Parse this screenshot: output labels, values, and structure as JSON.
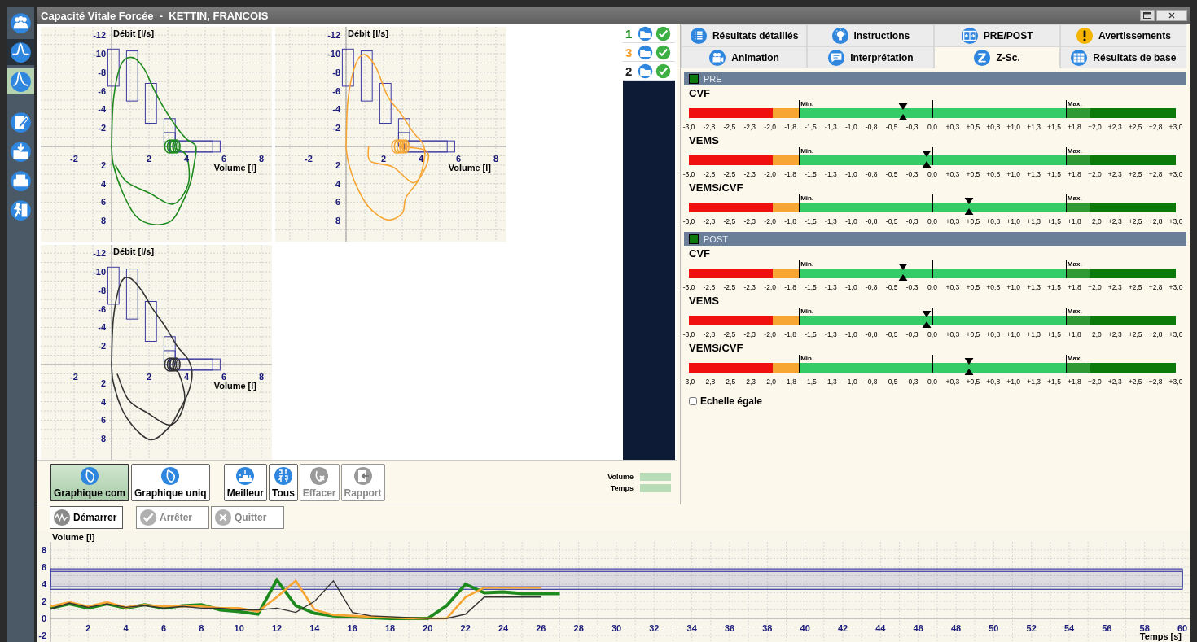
{
  "window": {
    "title": "Capacité Vitale Forcée  -  KETTIN, FRANCOIS"
  },
  "sidebar": {
    "items": [
      {
        "kind": "patients",
        "selected": false,
        "highlighted": false
      },
      {
        "kind": "wave",
        "selected": false,
        "highlighted": true
      },
      {
        "kind": "peak",
        "selected": true,
        "highlighted": false
      },
      {
        "kind": "edit",
        "selected": false,
        "highlighted": false
      },
      {
        "kind": "import",
        "selected": false,
        "highlighted": false
      },
      {
        "kind": "print",
        "selected": false,
        "highlighted": false
      },
      {
        "kind": "exit",
        "selected": false,
        "highlighted": false
      }
    ]
  },
  "flow_volume_charts": [
    {
      "ylabel": "Débit [l/s]",
      "xlabel": "Volume [l]",
      "color": "#1e8a1e",
      "yticks": [
        "-12",
        "-10",
        "-8",
        "-6",
        "-4",
        "-2",
        "2",
        "4",
        "6",
        "8"
      ],
      "xticks": [
        "-2",
        "2",
        "4",
        "6",
        "8"
      ]
    },
    {
      "ylabel": "Débit [l/s]",
      "xlabel": "Volume [l]",
      "color": "#f7a533",
      "yticks": [
        "-12",
        "-10",
        "-8",
        "-6",
        "-4",
        "-2",
        "2",
        "4",
        "6",
        "8"
      ],
      "xticks": [
        "-2",
        "2",
        "4",
        "6",
        "8"
      ]
    },
    {
      "ylabel": "Débit [l/s]",
      "xlabel": "Volume [l]",
      "color": "#333333",
      "yticks": [
        "-12",
        "-10",
        "-8",
        "-6",
        "-4",
        "-2",
        "2",
        "4",
        "6",
        "8"
      ],
      "xticks": [
        "-2",
        "2",
        "4",
        "6",
        "8"
      ]
    }
  ],
  "trials": [
    {
      "number": "1",
      "color": "#1a8a1a"
    },
    {
      "number": "3",
      "color": "#f39a1f"
    },
    {
      "number": "2",
      "color": "#222222"
    }
  ],
  "tab_rows": [
    [
      {
        "label": "Résultats détaillés",
        "kind": "list",
        "selected": false
      },
      {
        "label": "Instructions",
        "kind": "bulb",
        "selected": false
      },
      {
        "label": "PRE/POST",
        "kind": "prepost",
        "selected": false
      },
      {
        "label": "Avertissements",
        "kind": "warning",
        "selected": false
      }
    ],
    [
      {
        "label": "Animation",
        "kind": "camera",
        "selected": false
      },
      {
        "label": "Interprétation",
        "kind": "chat",
        "selected": false
      },
      {
        "label": "Z-Sc.",
        "kind": "z",
        "selected": true
      },
      {
        "label": "Résultats de base",
        "kind": "grid",
        "selected": false
      }
    ]
  ],
  "zscore": {
    "sections": [
      {
        "title": "PRE",
        "metrics": [
          {
            "name": "CVF",
            "min_label": "Min.",
            "max_label": "Max.",
            "level": 0.44,
            "ticks": [
              "-3,0",
              "-2,8",
              "-2,5",
              "-2,3",
              "-2,0",
              "-1,8",
              "-1,5",
              "-1,3",
              "-1,0",
              "-0,8",
              "-0,5",
              "-0,3",
              "0,0",
              "+0,3",
              "+0,5",
              "+0,8",
              "+1,0",
              "+1,3",
              "+1,5",
              "+1,8",
              "+2,0",
              "+2,3",
              "+2,5",
              "+2,8",
              "+3,0"
            ]
          },
          {
            "name": "VEMS",
            "min_label": "Min.",
            "max_label": "Max.",
            "level": 0.488,
            "ticks": [
              "-3,0",
              "-2,8",
              "-2,5",
              "-2,3",
              "-2,0",
              "-1,8",
              "-1,5",
              "-1,3",
              "-1,0",
              "-0,8",
              "-0,5",
              "-0,3",
              "0,0",
              "+0,3",
              "+0,5",
              "+0,8",
              "+1,0",
              "+1,3",
              "+1,5",
              "+1,8",
              "+2,0",
              "+2,3",
              "+2,5",
              "+2,8",
              "+3,0"
            ]
          },
          {
            "name": "VEMS/CVF",
            "min_label": "Min.",
            "max_label": "Max.",
            "level": 0.575,
            "ticks": [
              "-3,0",
              "-2,8",
              "-2,5",
              "-2,3",
              "-2,0",
              "-1,8",
              "-1,5",
              "-1,3",
              "-1,0",
              "-0,8",
              "-0,5",
              "-0,3",
              "0,0",
              "+0,3",
              "+0,5",
              "+0,8",
              "+1,0",
              "+1,3",
              "+1,5",
              "+1,8",
              "+2,0",
              "+2,3",
              "+2,5",
              "+2,8",
              "+3,0"
            ]
          }
        ]
      },
      {
        "title": "POST",
        "metrics": [
          {
            "name": "CVF",
            "min_label": "Min.",
            "max_label": "Max.",
            "level": 0.44,
            "ticks": [
              "-3,0",
              "-2,8",
              "-2,5",
              "-2,3",
              "-2,0",
              "-1,8",
              "-1,5",
              "-1,3",
              "-1,0",
              "-0,8",
              "-0,5",
              "-0,3",
              "0,0",
              "+0,3",
              "+0,5",
              "+0,8",
              "+1,0",
              "+1,3",
              "+1,5",
              "+1,8",
              "+2,0",
              "+2,3",
              "+2,5",
              "+2,8",
              "+3,0"
            ]
          },
          {
            "name": "VEMS",
            "min_label": "Min.",
            "max_label": "Max.",
            "level": 0.488,
            "ticks": [
              "-3,0",
              "-2,8",
              "-2,5",
              "-2,3",
              "-2,0",
              "-1,8",
              "-1,5",
              "-1,3",
              "-1,0",
              "-0,8",
              "-0,5",
              "-0,3",
              "0,0",
              "+0,3",
              "+0,5",
              "+0,8",
              "+1,0",
              "+1,3",
              "+1,5",
              "+1,8",
              "+2,0",
              "+2,3",
              "+2,5",
              "+2,8",
              "+3,0"
            ]
          },
          {
            "name": "VEMS/CVF",
            "min_label": "Min.",
            "max_label": "Max.",
            "level": 0.575,
            "ticks": [
              "-3,0",
              "-2,8",
              "-2,5",
              "-2,3",
              "-2,0",
              "-1,8",
              "-1,5",
              "-1,3",
              "-1,0",
              "-0,8",
              "-0,5",
              "-0,3",
              "0,0",
              "+0,3",
              "+0,5",
              "+0,8",
              "+1,0",
              "+1,3",
              "+1,5",
              "+1,8",
              "+2,0",
              "+2,3",
              "+2,5",
              "+2,8",
              "+3,0"
            ]
          }
        ]
      }
    ],
    "equal_scale": {
      "label": "Echelle égale",
      "checked": false
    }
  },
  "toolbar": {
    "buttons": [
      {
        "label": "Graphique com",
        "kind": "curve",
        "selected": true,
        "disabled": false
      },
      {
        "label": "Graphique uniq",
        "kind": "curve",
        "selected": false,
        "disabled": false
      },
      {
        "label": "Meilleur",
        "kind": "podium",
        "selected": false,
        "disabled": false
      },
      {
        "label": "Tous",
        "kind": "numbers",
        "selected": false,
        "disabled": false
      },
      {
        "label": "Effacer",
        "kind": "erase",
        "selected": false,
        "disabled": true
      },
      {
        "label": "Rapport",
        "kind": "report",
        "selected": false,
        "disabled": true
      }
    ],
    "legend": [
      {
        "label": "Volume"
      },
      {
        "label": "Temps"
      }
    ]
  },
  "actions": [
    {
      "label": "Démarrer",
      "kind": "start",
      "disabled": false
    },
    {
      "label": "Arrêter",
      "kind": "stop",
      "disabled": true
    },
    {
      "label": "Quitter",
      "kind": "quit",
      "disabled": true
    }
  ],
  "volume_time_chart": {
    "chart_data": {
      "type": "line",
      "grid": true,
      "bands": [
        {
          "axis": "y",
          "from": 3.4,
          "to": 5.8
        },
        {
          "axis": "y",
          "from": 3.7,
          "to": 5.5
        }
      ],
      "xlabel": "Temps [s]",
      "ylabel": "Volume [l]",
      "xlim": [
        0,
        60
      ],
      "ylim": [
        -2,
        8
      ],
      "xticks": [
        2,
        4,
        6,
        8,
        10,
        12,
        14,
        16,
        18,
        20,
        22,
        24,
        26,
        28,
        30,
        32,
        34,
        36,
        38,
        40,
        42,
        44,
        46,
        48,
        50,
        52,
        54,
        56,
        58,
        60
      ],
      "yticks": [
        -2,
        0,
        2,
        4,
        6,
        8
      ],
      "x": [
        0,
        1,
        2,
        3,
        4,
        5,
        6,
        7,
        8,
        9,
        10,
        11,
        12,
        13,
        14,
        15,
        16,
        17,
        18,
        19,
        20,
        21,
        22,
        23,
        24,
        25,
        26,
        27
      ],
      "series": [
        {
          "color": "#1e8a1e",
          "values": [
            1.2,
            1.7,
            1.2,
            1.7,
            1.2,
            1.6,
            1.2,
            1.5,
            1.6,
            1.0,
            0.8,
            0.5,
            4.5,
            1.5,
            0.6,
            0.3,
            0.2,
            0.1,
            0,
            0,
            0,
            1.5,
            4.0,
            3.0,
            3.1,
            2.9,
            2.9,
            2.9
          ]
        },
        {
          "color": "#f7a533",
          "values": [
            1.4,
            1.9,
            1.4,
            1.9,
            1.3,
            1.6,
            1.4,
            1.4,
            1.4,
            1.2,
            1.2,
            0.8,
            2.5,
            4.4,
            1.0,
            0.4,
            0.3,
            0.2,
            0.1,
            0,
            0,
            0,
            2.5,
            3.6,
            3.6,
            3.6,
            3.6,
            null
          ]
        },
        {
          "color": "#333333",
          "values": [
            1.1,
            1.8,
            1.3,
            1.7,
            1.3,
            1.5,
            1.2,
            1.4,
            1.2,
            1.2,
            1.0,
            1.0,
            1.2,
            0.7,
            2.0,
            4.4,
            0.7,
            0.3,
            0.2,
            0.1,
            0,
            0,
            0.5,
            2.5,
            2.5,
            2.5,
            2.5,
            null
          ]
        }
      ]
    }
  }
}
